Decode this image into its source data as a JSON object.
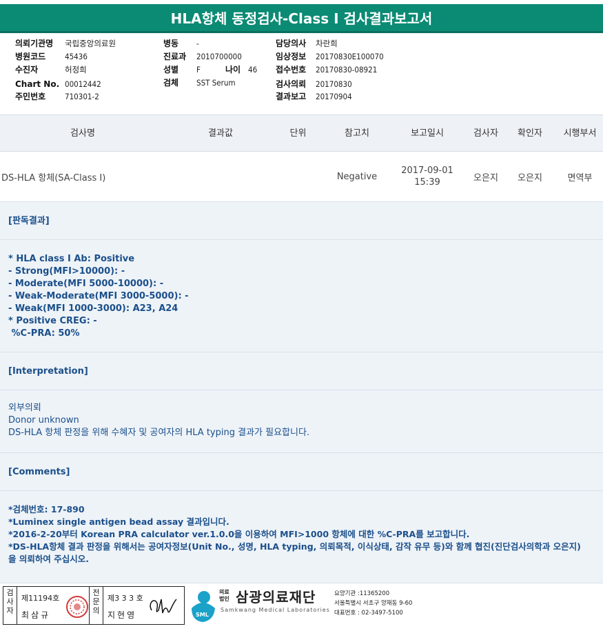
{
  "title": "HLA항체 동정검사-Class I 검사결과보고서",
  "patient": {
    "institution_label": "의뢰기관명",
    "institution": "국립중앙의료원",
    "hospital_code_label": "병원코드",
    "hospital_code": "45436",
    "patient_name_label": "수진자",
    "patient_name": "허정희",
    "chart_no_label": "Chart No.",
    "chart_no": "00012442",
    "resident_no_label": "주민번호",
    "resident_no": "710301-2",
    "ward_label": "병동",
    "ward": "-",
    "dept_label": "진료과",
    "dept": "2010700000",
    "sex_label": "성별",
    "sex": "F",
    "age_label": "나이",
    "age": "46",
    "specimen_label": "검체",
    "specimen": "SST Serum",
    "doctor_label": "담당의사",
    "doctor": "차란희",
    "clinical_label": "임상정보",
    "clinical": "20170830E100070",
    "accession_label": "접수번호",
    "accession": "20170830-08921",
    "request_label": "검사의뢰",
    "request": "20170830",
    "report_label": "결과보고",
    "report": "20170904"
  },
  "table": {
    "headers": [
      "검사명",
      "결과값",
      "단위",
      "참고치",
      "보고일시",
      "검사자",
      "확인자",
      "시행부서"
    ],
    "row": {
      "test_name": "DS-HLA 항체(SA-Class I)",
      "result": "",
      "unit": "",
      "reference": "Negative",
      "report_date": "2017-09-01",
      "report_time": "15:39",
      "tester": "오은지",
      "verifier": "오은지",
      "department": "면역부"
    }
  },
  "sections": {
    "reading_title": "[판독결과]",
    "reading_body": "* HLA class I Ab: Positive\n- Strong(MFI>10000): -\n- Moderate(MFI 5000-10000): -\n- Weak-Moderate(MFI 3000-5000): -\n- Weak(MFI 1000-3000): A23, A24\n* Positive CREG: -\n %C-PRA: 50%",
    "interp_title": "[Interpretation]",
    "interp_body": "외부의뢰\nDonor unknown\nDS-HLA 항체 판정을 위해 수혜자 및 공여자의 HLA typing 결과가 필요합니다.",
    "comments_title": "[Comments]",
    "comments_body": "*검체번호: 17-890\n*Luminex single antigen bead assay 결과입니다.\n*2016-2-20부터 Korean PRA calculator ver.1.0.0을 이용하여 MFI>1000 항체에 대한 %C-PRA를 보고합니다.\n*DS-HLA항체 결과 판정을 위해서는 공여자정보(Unit No., 성명, HLA typing, 의뢰목적, 이식상태, 감작 유무 등)와 함께 협진(진단검사의학과 오은지)\n을 의뢰하여 주십시오."
  },
  "footer": {
    "sig1_vertical": "검\n사\n자",
    "sig1_number": "제11194호",
    "sig1_name": "최삼규",
    "sig2_vertical": "전\n문\n의",
    "sig2_number": "제3 3 3 호",
    "sig2_name": "지현영",
    "logo_text": "SML",
    "inst_type": "의료\n법인",
    "inst_name": "삼광의료재단",
    "inst_en": "Samkwang Medical Laboratories",
    "inst_info": "요양기관 :11365200\n서울특별시 서초구 양재동 9-60\n대표번호 : 02-3497-5100",
    "accent_color": "#0b8a74",
    "logo_color": "#1aa2c9"
  }
}
